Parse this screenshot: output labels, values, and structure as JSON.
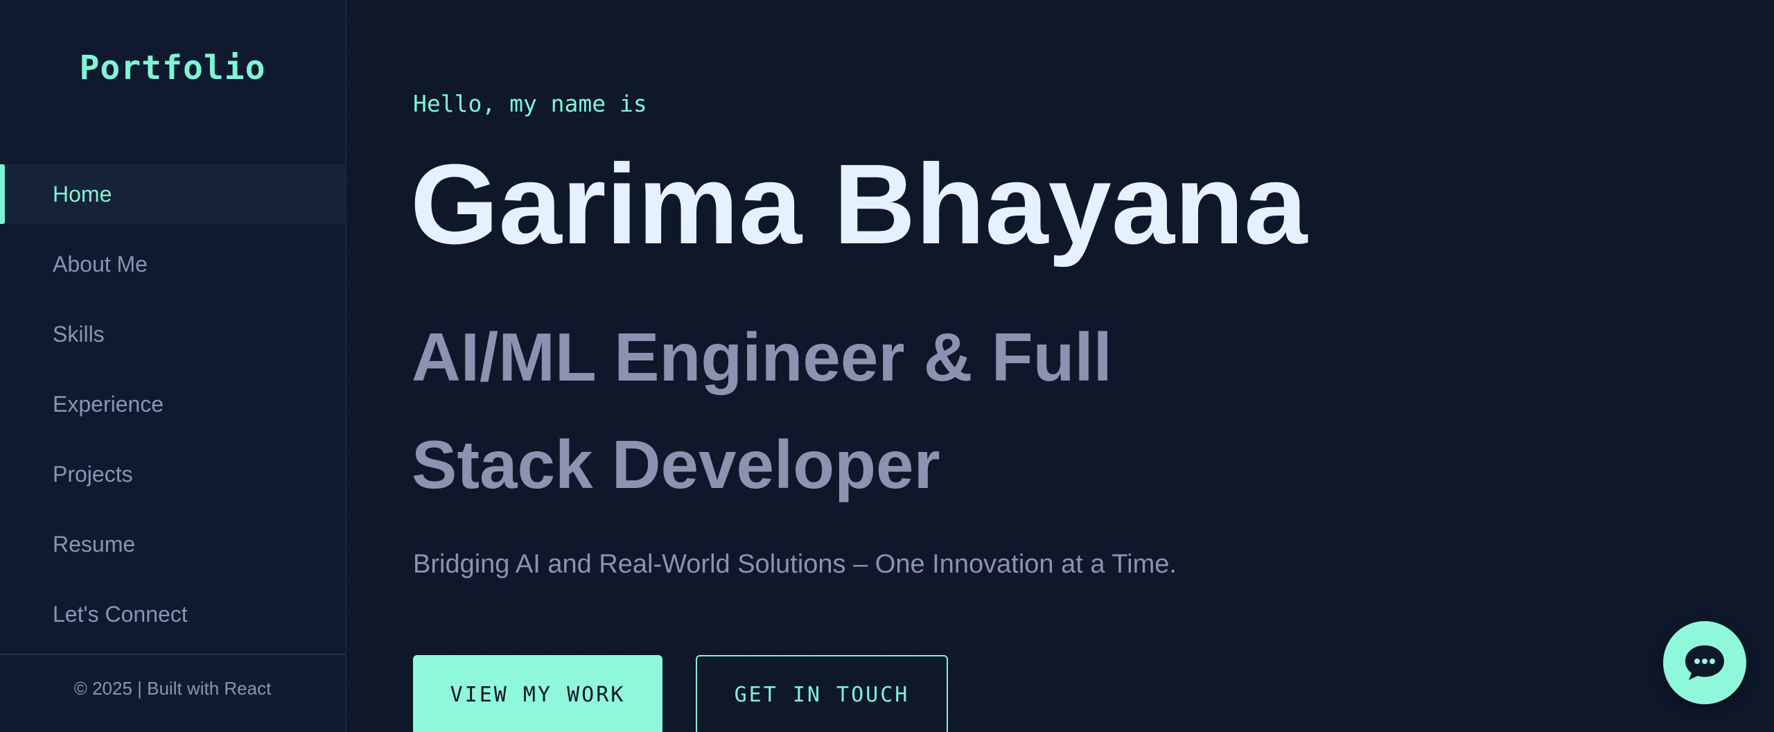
{
  "sidebar": {
    "logo": "Portfolio",
    "items": [
      {
        "label": "Home",
        "active": true
      },
      {
        "label": "About Me",
        "active": false
      },
      {
        "label": "Skills",
        "active": false
      },
      {
        "label": "Experience",
        "active": false
      },
      {
        "label": "Projects",
        "active": false
      },
      {
        "label": "Resume",
        "active": false
      },
      {
        "label": "Let's Connect",
        "active": false
      }
    ],
    "footer": "© 2025 | Built with React"
  },
  "hero": {
    "greeting": "Hello, my name is",
    "name": "Garima Bhayana",
    "role": "AI/ML Engineer & Full Stack Developer",
    "tagline": "Bridging AI and Real-World Solutions – One Innovation at a Time.",
    "primary_button": "VIEW MY WORK",
    "secondary_button": "GET IN TOUCH"
  },
  "chat": {
    "icon": "chat-bubble-icon"
  },
  "colors": {
    "background": "#0f172a",
    "sidebar_background": "#0f1a30",
    "accent": "#7ff5d6",
    "name_text": "#e6f1ff",
    "muted_text": "#8c93b1"
  }
}
